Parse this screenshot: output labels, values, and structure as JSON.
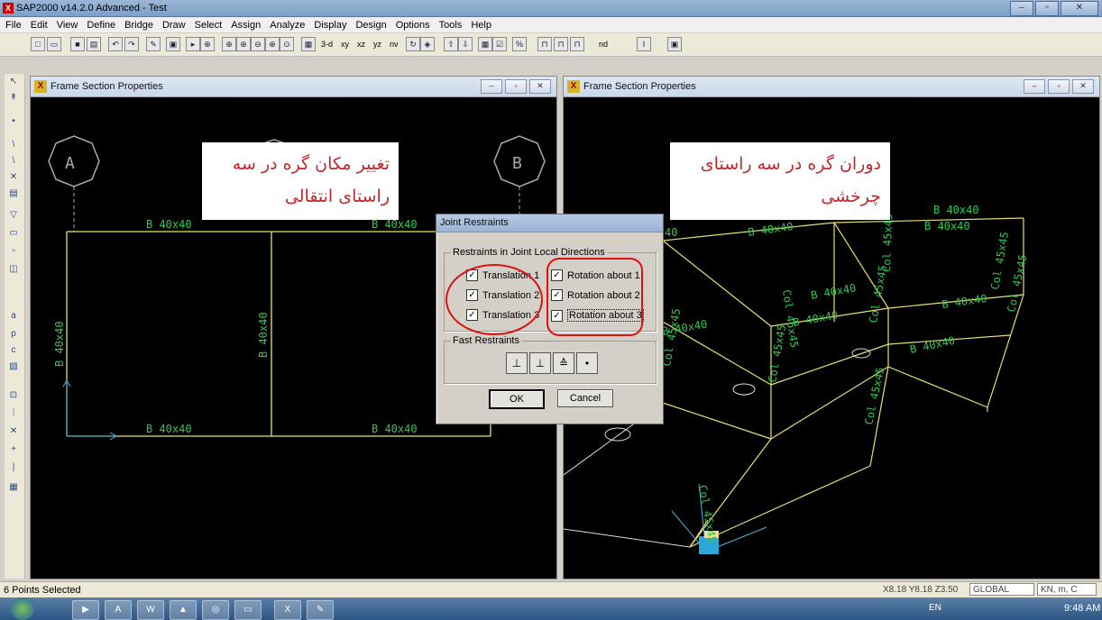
{
  "app": {
    "title": "SAP2000 v14.2.0 Advanced  - Test",
    "logo": "X"
  },
  "menu": [
    "File",
    "Edit",
    "View",
    "Define",
    "Bridge",
    "Draw",
    "Select",
    "Assign",
    "Analyze",
    "Display",
    "Design",
    "Options",
    "Tools",
    "Help"
  ],
  "toolbar": {
    "view_3d": "3-d",
    "view_xy": "xy",
    "view_xz": "xz",
    "view_yz": "yz",
    "view_nv": "nv",
    "nd": "nd"
  },
  "left_pane": {
    "title": "Frame Section Properties",
    "grid_a": "A",
    "grid_b": "B",
    "beam_top_left": "B 40x40",
    "beam_top_right": "B 40x40",
    "beam_bottom_left": "B 40x40",
    "beam_bottom_right": "B 40x40",
    "col_left": "B 40x40",
    "col_middle": "B 40x40",
    "note": "تغییر مکان گره در سه راستای انتقالی"
  },
  "right_pane": {
    "title": "Frame Section Properties",
    "note": "دوران گره در سه راستای چرخشی",
    "labels": [
      "B 40x40",
      "B 40x40",
      "B 40x40",
      "B 40x40",
      "B 40x40",
      "B 40x40",
      "B 40x40",
      "Col 45x45",
      "Col 45x45",
      "Col 45x45",
      "Col 45x45",
      "Col 45x45",
      "Col 45x45",
      "Col 45x45",
      "Col 45x45",
      "40",
      "Col 45x45"
    ]
  },
  "dialog": {
    "title": "Joint Restraints",
    "group_label": "Restraints in Joint Local Directions",
    "translation_1": "Translation 1",
    "translation_2": "Translation 2",
    "translation_3": "Translation 3",
    "rotation_1": "Rotation about 1",
    "rotation_2": "Rotation about 2",
    "rotation_3": "Rotation about 3",
    "fast_label": "Fast Restraints",
    "ok": "OK",
    "cancel": "Cancel"
  },
  "status": {
    "selection": "6 Points Selected",
    "coords": "X8.18  Y8.18  Z3.50",
    "coord_system": "GLOBAL",
    "units": "KN, m, C"
  },
  "taskbar": {
    "lang": "EN",
    "time": "9:48 AM"
  },
  "colors": {
    "structure": "#e8e070",
    "label_green": "#30c850",
    "annotation_red": "#c1272d",
    "annotation_ring": "#d11"
  }
}
